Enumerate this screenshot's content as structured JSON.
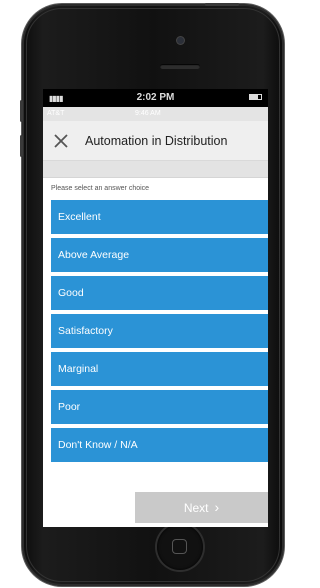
{
  "device": {
    "time": "2:02 PM"
  },
  "app_status": {
    "carrier": "AT&T",
    "time": "9:46 AM"
  },
  "header": {
    "title": "Automation in Distribution",
    "close_icon": "close-icon"
  },
  "question": {
    "prompt": "Please select an answer choice",
    "choices": [
      "Excellent",
      "Above Average",
      "Good",
      "Satisfactory",
      "Marginal",
      "Poor",
      "Don't Know / N/A"
    ]
  },
  "footer": {
    "next_label": "Next",
    "next_icon": "chevron-right-icon"
  },
  "colors": {
    "choice_bg": "#2b93d6",
    "next_bg": "#c9c9c9",
    "header_bg": "#efefef"
  }
}
